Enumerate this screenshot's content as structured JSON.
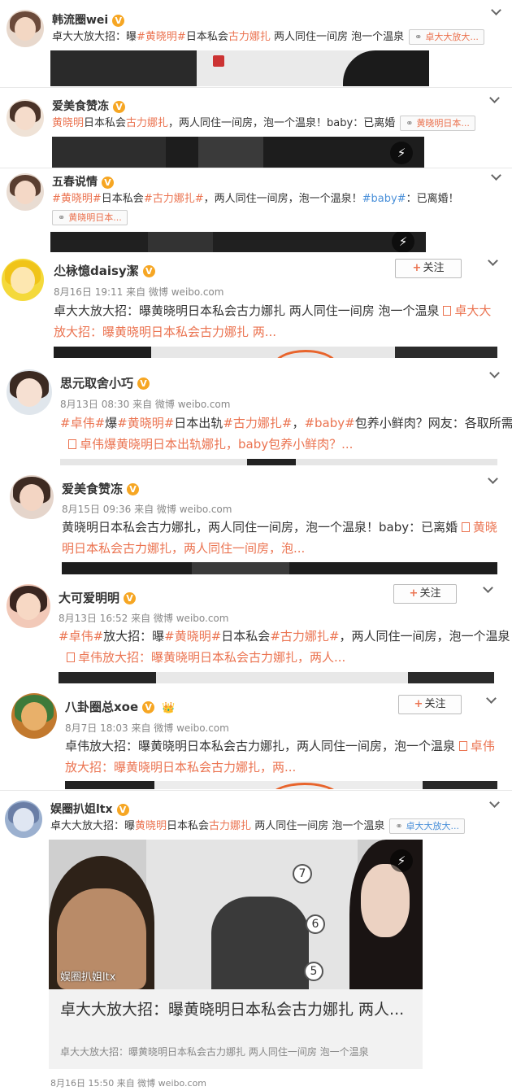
{
  "posts": [
    {
      "user": "韩流圈wei",
      "text_parts": [
        "卓大大放大招：曝",
        "#黄晓明#",
        "日本私会",
        "古力娜扎",
        " 两人同住一间房 泡一个温泉"
      ],
      "chip": "卓大大放大..."
    },
    {
      "user": "爱美食赞冻",
      "text_parts": [
        "黄晓明",
        "日本私会",
        "古力娜扎",
        "，两人同住一间房，泡一个温泉！baby：已离婚"
      ],
      "chip": "黄晓明日本..."
    },
    {
      "user": "五春说情",
      "text_parts": [
        "#黄晓明#",
        "日本私会",
        "#古力娜扎#",
        "，两人同住一间房，泡一个温泉！",
        "#baby#",
        "：已离婚！"
      ],
      "chip": "黄晓明日本..."
    },
    {
      "user": "尐栐憶daisy潔",
      "follow": "关注",
      "meta": "8月16日 19:11 来自 微博 weibo.com",
      "text": "卓大大放大招：曝黄晓明日本私会古力娜扎 两人同住一间房 泡一个温泉",
      "link_head": "卓",
      "link_tail": "大大放大招：曝黄晓明日本私会古力娜扎 两..."
    },
    {
      "user": "思元取舍小巧",
      "meta": "8月13日 08:30 来自 微博 weibo.com",
      "text_parts": [
        "#卓伟#",
        "爆",
        "#黄晓明#",
        "日本出轨",
        "#古力娜扎#",
        "，",
        "#baby#",
        "包养小鲜肉？网友：各取所需"
      ],
      "link": "卓伟爆黄晓明日本出轨娜扎，baby包养小鲜肉？..."
    },
    {
      "user": "爱美食赞冻",
      "meta": "8月15日 09:36 来自 微博 weibo.com",
      "text": "黄晓明日本私会古力娜扎，两人同住一间房，泡一个温泉！baby：已离婚",
      "link_head": "黄",
      "link_tail": "晓明日本私会古力娜扎，两人同住一间房，泡..."
    },
    {
      "user": "大可爱明明",
      "follow": "关注",
      "meta": "8月13日 16:52 来自 微博 weibo.com",
      "text_parts": [
        "#卓伟#",
        "放大招：曝",
        "#黄晓明#",
        "日本私会",
        "#古力娜扎#",
        "，两人同住一间房，泡一个温泉"
      ],
      "link": "卓伟放大招：曝黄晓明日本私会古力娜扎，两人..."
    },
    {
      "user": "八卦圈总xoe",
      "follow": "关注",
      "meta": "8月7日 18:03 来自 微博 weibo.com",
      "text": "卓伟放大招：曝黄晓明日本私会古力娜扎，两人同住一间房，泡一个温泉",
      "link_head": "卓",
      "link_tail": "伟放大招：曝黄晓明日本私会古力娜扎，两..."
    },
    {
      "user": "娱圈扒姐ltx",
      "text_parts": [
        "卓大大放大招：曝",
        "黄晓明",
        "日本私会",
        "古力娜扎",
        " 两人同住一间房 泡一个温泉"
      ],
      "chip": "卓大大放大...",
      "watermark": "娱圈扒姐ltx",
      "card_title": "卓大大放大招：曝黄晓明日本私会古力娜扎 两人...",
      "card_desc": "卓大大放大招：曝黄晓明日本私会古力娜扎 两人同住一间房 泡一个温泉",
      "meta": "8月16日 15:50 来自 微博 weibo.com"
    }
  ],
  "icons": {
    "verified": "V",
    "bolt": "⚡",
    "follow_plus": "+",
    "clip": "🔗",
    "crown": "👑"
  },
  "colors": {
    "link": "#eb7350",
    "verified": "#f6a623"
  }
}
